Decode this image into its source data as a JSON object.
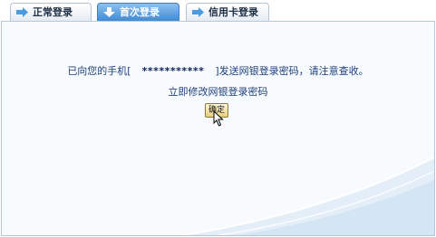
{
  "tabs": [
    {
      "label": "正常登录",
      "icon": "arrow-right-icon"
    },
    {
      "label": "首次登录",
      "icon": "arrow-down-icon",
      "active": true
    },
    {
      "label": "信用卡登录",
      "icon": "arrow-right-icon"
    }
  ],
  "message": {
    "prefix": "已向您的手机[",
    "masked_number": "***********",
    "suffix": "]发送网银登录密码，请注意查收。"
  },
  "link": {
    "label": "立即修改网银登录密码"
  },
  "confirm_button": {
    "label": "确定"
  },
  "colors": {
    "active_tab": "#3f8bd6",
    "text": "#1f3f7a",
    "panel_bg": "#f7fbfe"
  }
}
